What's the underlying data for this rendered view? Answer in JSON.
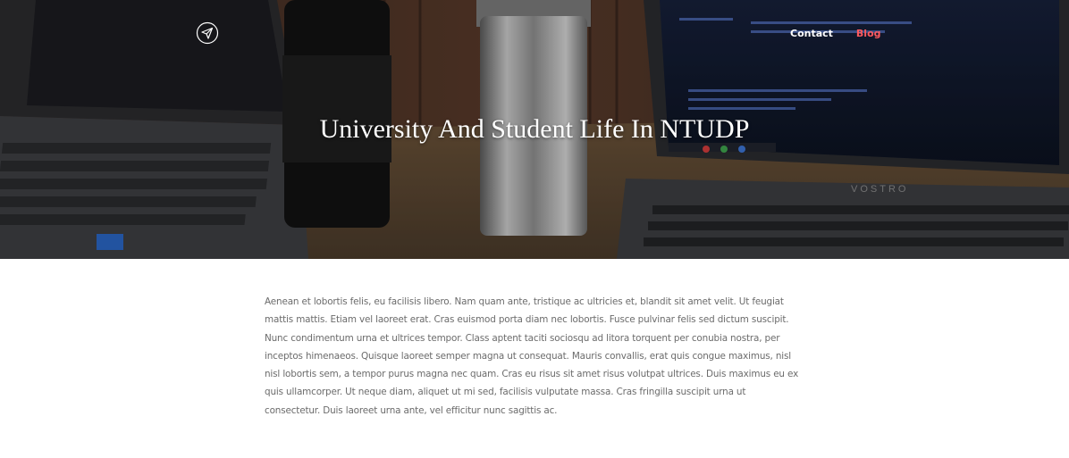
{
  "header": {
    "logo_icon": "paper-plane-icon",
    "nav": {
      "contact_label": "Contact",
      "blog_label": "Blog"
    },
    "active_color": "#ff5a5f"
  },
  "hero": {
    "title": "University And Student Life In NTUDP",
    "background": "laptops-and-tumblers-on-desk-photo",
    "laptop_brand": "VOSTRO"
  },
  "article": {
    "body": "Aenean et lobortis felis, eu facilisis libero. Nam quam ante, tristique ac ultricies et, blandit sit amet velit. Ut feugiat mattis mattis. Etiam vel laoreet erat. Cras euismod porta diam nec lobortis. Fusce pulvinar felis sed dictum suscipit. Nunc condimentum urna et ultrices tempor. Class aptent taciti sociosqu ad litora torquent per conubia nostra, per inceptos himenaeos. Quisque laoreet semper magna ut consequat. Mauris convallis, erat quis congue maximus, nisl nisl lobortis sem, a tempor purus magna nec quam. Cras eu risus sit amet risus volutpat ultrices. Duis maximus eu ex quis ullamcorper. Ut neque diam, aliquet ut mi sed, facilisis vulputate massa. Cras fringilla suscipit urna ut consectetur. Duis laoreet urna ante, vel efficitur nunc sagittis ac."
  }
}
